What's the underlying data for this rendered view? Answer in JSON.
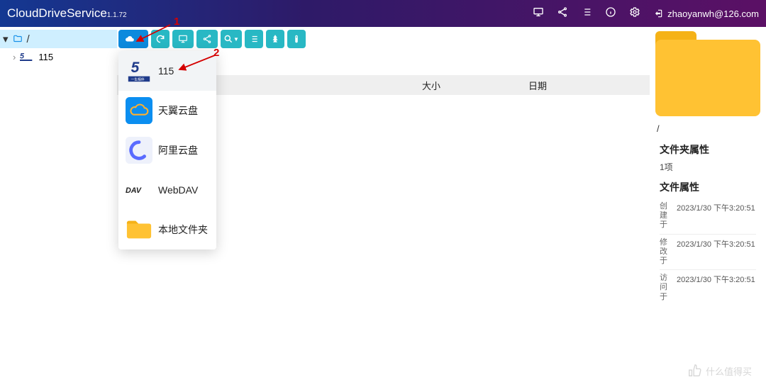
{
  "header": {
    "title": "CloudDriveService",
    "version": "1.1.72",
    "user": "zhaoyanwh@126.com"
  },
  "tree": {
    "root": "/",
    "items": [
      {
        "label": "115"
      }
    ]
  },
  "columns": {
    "name": "",
    "size": "大小",
    "date": "日期"
  },
  "dropdown": [
    {
      "label": "115"
    },
    {
      "label": "天翼云盘"
    },
    {
      "label": "阿里云盘"
    },
    {
      "label": "WebDAV"
    },
    {
      "label": "本地文件夹"
    }
  ],
  "annotations": {
    "one": "1",
    "two": "2"
  },
  "right": {
    "path": "/",
    "folder_props_title": "文件夹属性",
    "item_count": "1项",
    "file_props_title": "文件属性",
    "rows": [
      {
        "k": "创建于",
        "v": "2023/1/30 下午3:20:51"
      },
      {
        "k": "修改于",
        "v": "2023/1/30 下午3:20:51"
      },
      {
        "k": "访问于",
        "v": "2023/1/30 下午3:20:51"
      }
    ]
  },
  "watermark": "什么值得买"
}
